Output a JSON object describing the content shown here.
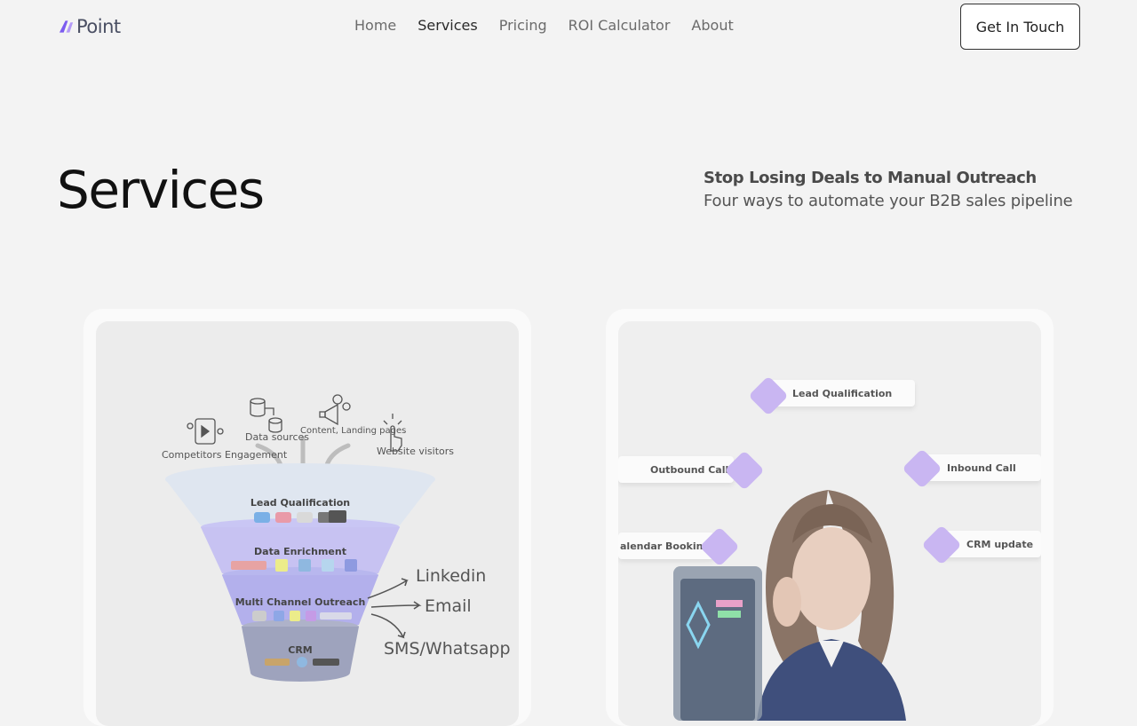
{
  "nav": {
    "logo": "Point",
    "items": [
      "Home",
      "Services",
      "Pricing",
      "ROI Calculator",
      "About"
    ],
    "active": "Services",
    "cta": "Get In Touch"
  },
  "hero": {
    "title": "Services",
    "tagline_heading": "Stop Losing Deals to Manual Outreach",
    "tagline_sub": "Four ways to automate your B2B sales pipeline"
  },
  "funnel": {
    "sources": [
      "Competitors Engagement",
      "Data sources",
      "Content, Landing pages",
      "Website visitors"
    ],
    "stages": [
      "Lead Qualification",
      "Data Enrichment",
      "Multi Channel Outreach",
      "CRM"
    ],
    "channels": [
      "Linkedin",
      "Email",
      "SMS/Whatsapp"
    ]
  },
  "agent": {
    "badges": [
      "Lead Qualification",
      "Outbound Call",
      "Inbound Call",
      "alendar Booking",
      "CRM update"
    ]
  },
  "colors": {
    "accent": "#8b5cf6",
    "funnel_top": "#dfe6f0",
    "funnel_mid": "#c7c2f2",
    "funnel_bottom": "#9ea3bd"
  }
}
